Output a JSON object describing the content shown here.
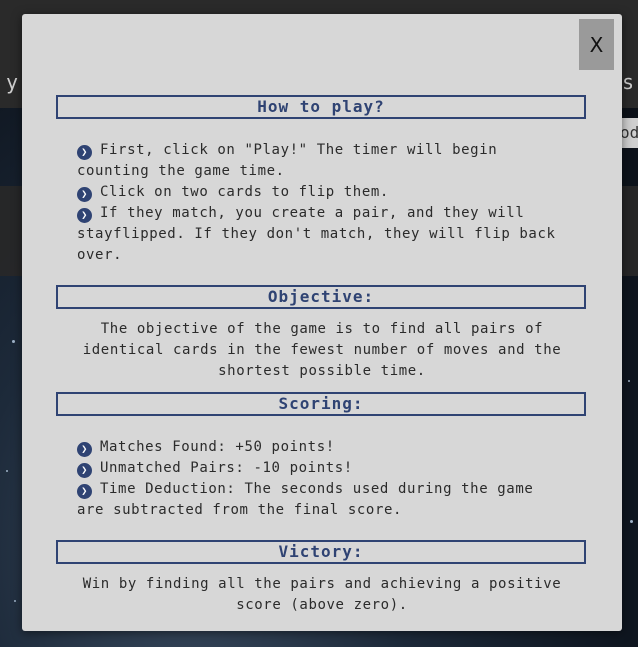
{
  "background": {
    "left_fragment": "y",
    "right_fragment": "s",
    "chip_fragment": "od"
  },
  "modal": {
    "close_label": "X",
    "how_to_play": {
      "title": "How to play?",
      "items": [
        "First, click on \"Play!\" The timer will begin counting the game time.",
        "Click on two cards to flip them.",
        "If they match, you create a pair, and they will stayflipped. If they don't match, they will flip back over."
      ]
    },
    "objective": {
      "title": "Objective:",
      "text": "The objective of the game is to find all pairs of identical cards in the fewest number of moves and the shortest possible time."
    },
    "scoring": {
      "title": "Scoring:",
      "items": [
        "Matches Found: +50 points!",
        "Unmatched Pairs: -10 points!",
        "Time Deduction: The seconds used during the game are subtracted from the final score."
      ]
    },
    "victory": {
      "title": "Victory:",
      "text": "Win by finding all the pairs and achieving a positive score (above zero)."
    }
  },
  "colors": {
    "accent": "#2f4373",
    "modal_bg": "#d7d7d7",
    "close_bg": "#9a9a9a"
  },
  "icons": {
    "bullet": "chevron-right-circle-icon"
  }
}
